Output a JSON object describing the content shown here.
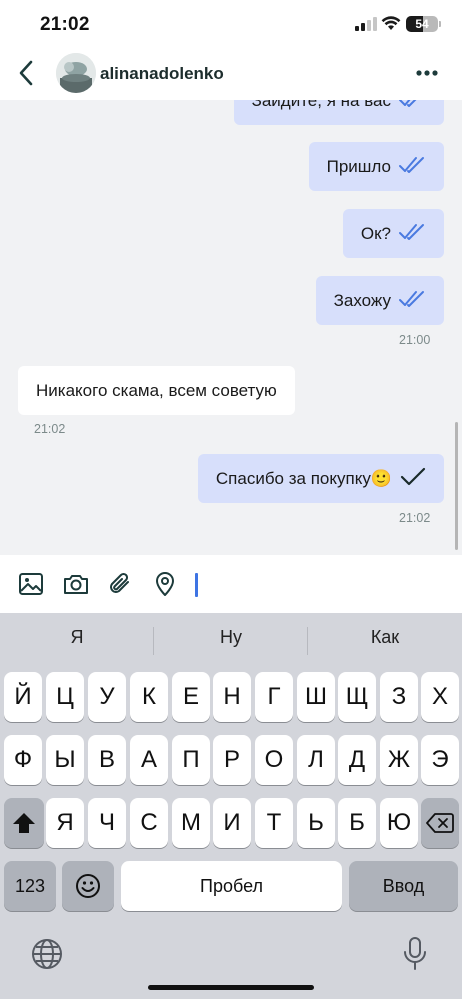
{
  "status_bar": {
    "time": "21:02",
    "battery": "54",
    "battery_level": 0.54
  },
  "header": {
    "contact_name": "alinanadolenko",
    "back_icon": "chevron-left-icon",
    "more_icon": "ellipsis-icon"
  },
  "messages": [
    {
      "text": "Зайдите, я на вас",
      "direction": "out",
      "status": "read"
    },
    {
      "text": "Пришло",
      "direction": "out",
      "status": "read"
    },
    {
      "text": "Ок?",
      "direction": "out",
      "status": "read"
    },
    {
      "text": "Захожу",
      "direction": "out",
      "status": "read",
      "time": "21:00"
    },
    {
      "text": "Никакого скама, всем советую",
      "direction": "in",
      "time": "21:02"
    },
    {
      "text": "Спасибо за покупку🙂",
      "direction": "out",
      "status": "sent",
      "time": "21:02"
    }
  ],
  "composer": {
    "tools": [
      "image-icon",
      "camera-icon",
      "paperclip-icon",
      "location-pin-icon"
    ],
    "value": ""
  },
  "keyboard": {
    "suggestions": [
      "Я",
      "Ну",
      "Как"
    ],
    "row1": [
      "Й",
      "Ц",
      "У",
      "К",
      "Е",
      "Н",
      "Г",
      "Ш",
      "Щ",
      "З",
      "Х"
    ],
    "row2": [
      "Ф",
      "Ы",
      "В",
      "А",
      "П",
      "Р",
      "О",
      "Л",
      "Д",
      "Ж",
      "Э"
    ],
    "row3": [
      "Я",
      "Ч",
      "С",
      "М",
      "И",
      "Т",
      "Ь",
      "Б",
      "Ю"
    ],
    "numbers_label": "123",
    "space_label": "Пробел",
    "return_label": "Ввод"
  },
  "colors": {
    "outgoing_bubble": "#d7dffb",
    "incoming_bubble": "#ffffff",
    "read_ticks": "#4a7ae0",
    "chat_background": "#f1f2f4"
  }
}
